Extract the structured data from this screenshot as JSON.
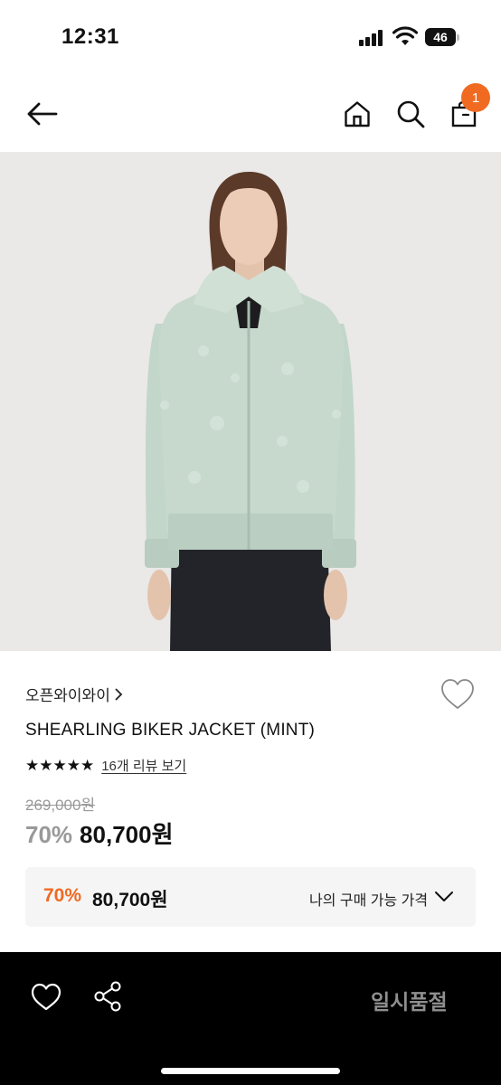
{
  "status_bar": {
    "time": "12:31",
    "battery": "46"
  },
  "nav": {
    "cart_count": "1"
  },
  "product": {
    "brand": "오픈와이와이",
    "name": "SHEARLING BIKER JACKET (MINT)",
    "rating_stars": 5,
    "stars_text": "★★★★★",
    "review_link": "16개 리뷰 보기",
    "original_price": "269,000원",
    "discount": "70%",
    "sale_price": "80,700원"
  },
  "my_price": {
    "discount": "70%",
    "price": "80,700원",
    "label": "나의 구매 가능 가격"
  },
  "bottom_bar": {
    "soldout_label": "일시품절"
  },
  "colors": {
    "accent": "#f06a21",
    "jacket": "#c7d9cd",
    "background": "#eae9e7"
  },
  "icons": [
    "back-arrow-icon",
    "home-icon",
    "search-icon",
    "bag-icon",
    "heart-icon",
    "share-icon",
    "chevron-down-icon"
  ]
}
